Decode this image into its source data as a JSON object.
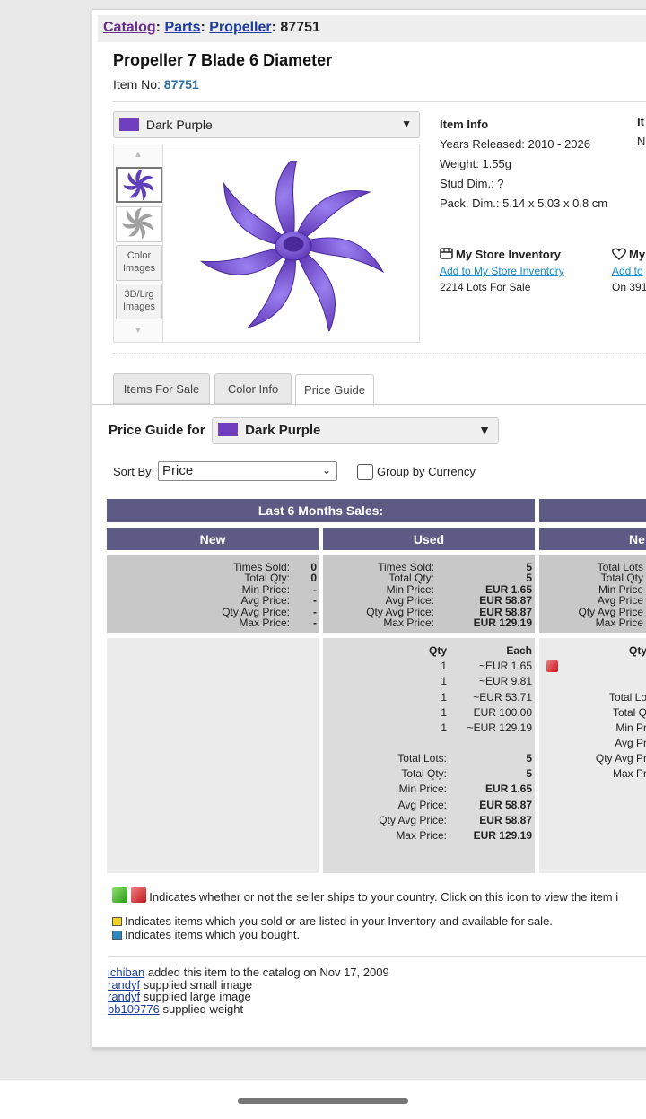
{
  "breadcrumb": {
    "catalog": "Catalog",
    "parts": "Parts",
    "propeller": "Propeller",
    "item": "87751",
    "sep": ":"
  },
  "item": {
    "title": "Propeller 7 Blade 6 Diameter",
    "item_no_label": "Item No:",
    "item_no": "87751"
  },
  "color_select": {
    "value": "Dark Purple",
    "swatch": "#6f3fbf"
  },
  "image_panel": {
    "color_images": "Color Images",
    "large_images": "3D/Lrg Images"
  },
  "item_info": {
    "heading": "Item Info",
    "years": "Years Released: 2010 - 2026",
    "weight": "Weight: 1.55g",
    "stud": "Stud Dim.: ?",
    "pack": "Pack. Dim.: 5.14 x 5.03 x 0.8 cm",
    "col2_heading": "It",
    "col2_value": "N"
  },
  "inventory": {
    "heading": "My Store Inventory",
    "link": "Add to My Store Inventory",
    "lots": "2214 Lots For Sale"
  },
  "wishlist": {
    "heading": "My",
    "link": "Add to",
    "value": "On 391"
  },
  "tabs": [
    "Items For Sale",
    "Color Info",
    "Price Guide"
  ],
  "price_guide": {
    "label": "Price Guide for",
    "color": "Dark Purple"
  },
  "sort": {
    "label": "Sort By:",
    "value": "Price",
    "group_label": "Group by Currency"
  },
  "table": {
    "header_6m": "Last 6 Months Sales:",
    "col_new": "New",
    "col_used": "Used",
    "col_new_cut": "Ne",
    "new_summary": {
      "labels": [
        "Times Sold:",
        "Total Qty:",
        "Min Price:",
        "Avg Price:",
        "Qty Avg Price:",
        "Max Price:"
      ],
      "values": [
        "0",
        "0",
        "-",
        "-",
        "-",
        "-"
      ]
    },
    "used_summary": {
      "labels": [
        "Times Sold:",
        "Total Qty:",
        "Min Price:",
        "Avg Price:",
        "Qty Avg Price:",
        "Max Price:"
      ],
      "values": [
        "5",
        "5",
        "EUR 1.65",
        "EUR 58.87",
        "EUR 58.87",
        "EUR 129.19"
      ]
    },
    "cut_summary_labels": [
      "Total Lots",
      "Total Qty",
      "Min Price",
      "Avg Price",
      "Qty Avg Price",
      "Max Price"
    ],
    "used_detail": {
      "qty_header": "Qty",
      "each_header": "Each",
      "rows": [
        {
          "qty": "1",
          "each": "~EUR 1.65"
        },
        {
          "qty": "1",
          "each": "~EUR 9.81"
        },
        {
          "qty": "1",
          "each": "~EUR 53.71"
        },
        {
          "qty": "1",
          "each": "EUR 100.00"
        },
        {
          "qty": "1",
          "each": "~EUR 129.19"
        }
      ],
      "totals_labels": [
        "Total Lots:",
        "Total Qty:",
        "Min Price:",
        "Avg Price:",
        "Qty Avg Price:",
        "Max Price:"
      ],
      "totals_values": [
        "5",
        "5",
        "EUR 1.65",
        "EUR 58.87",
        "EUR 58.87",
        "EUR 129.19"
      ]
    },
    "cut_detail": {
      "qty_header": "Qty",
      "labels": [
        "Total Lo",
        "Total Q",
        "Min Pr",
        "Avg Pr",
        "Qty Avg Pr",
        "Max Pr"
      ]
    }
  },
  "legend": {
    "ships": "Indicates whether or not the seller ships to your country. Click on this icon to view the item i",
    "sold": "Indicates items which you sold or are listed in your Inventory and available for sale.",
    "bought": "Indicates items which you bought."
  },
  "credits": [
    {
      "user": "ichiban",
      "text": "added this item to the catalog on Nov 17, 2009"
    },
    {
      "user": "randyf",
      "text": "supplied small image"
    },
    {
      "user": "randyf",
      "text": "supplied large image"
    },
    {
      "user": "bb109776",
      "text": "supplied weight"
    }
  ]
}
